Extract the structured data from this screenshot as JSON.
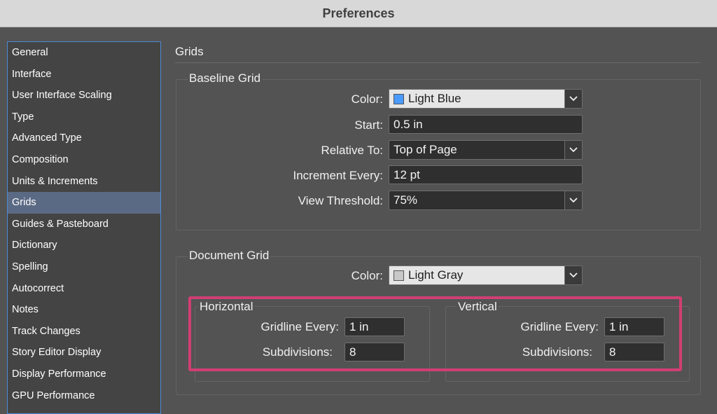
{
  "window": {
    "title": "Preferences"
  },
  "sidebar": {
    "items": [
      {
        "label": "General"
      },
      {
        "label": "Interface"
      },
      {
        "label": "User Interface Scaling"
      },
      {
        "label": "Type"
      },
      {
        "label": "Advanced Type"
      },
      {
        "label": "Composition"
      },
      {
        "label": "Units & Increments"
      },
      {
        "label": "Grids"
      },
      {
        "label": "Guides & Pasteboard"
      },
      {
        "label": "Dictionary"
      },
      {
        "label": "Spelling"
      },
      {
        "label": "Autocorrect"
      },
      {
        "label": "Notes"
      },
      {
        "label": "Track Changes"
      },
      {
        "label": "Story Editor Display"
      },
      {
        "label": "Display Performance"
      },
      {
        "label": "GPU Performance"
      }
    ],
    "selected": "Grids"
  },
  "main": {
    "title": "Grids",
    "baseline_grid": {
      "title": "Baseline Grid",
      "color_label": "Color:",
      "color_value": "Light Blue",
      "color_swatch": "#4a9bff",
      "start_label": "Start:",
      "start_value": "0.5 in",
      "relative_label": "Relative To:",
      "relative_value": "Top of Page",
      "increment_label": "Increment Every:",
      "increment_value": "12 pt",
      "threshold_label": "View Threshold:",
      "threshold_value": "75%"
    },
    "document_grid": {
      "title": "Document Grid",
      "color_label": "Color:",
      "color_value": "Light Gray",
      "color_swatch": "#c8c8c8",
      "horizontal": {
        "title": "Horizontal",
        "gridline_label": "Gridline Every:",
        "gridline_value": "1 in",
        "subdivisions_label": "Subdivisions:",
        "subdivisions_value": "8"
      },
      "vertical": {
        "title": "Vertical",
        "gridline_label": "Gridline Every:",
        "gridline_value": "1 in",
        "subdivisions_label": "Subdivisions:",
        "subdivisions_value": "8"
      }
    }
  },
  "colors": {
    "highlight": "#d03f72",
    "selection": "#5b6a84",
    "sidebar_border": "#4e8ad6"
  }
}
